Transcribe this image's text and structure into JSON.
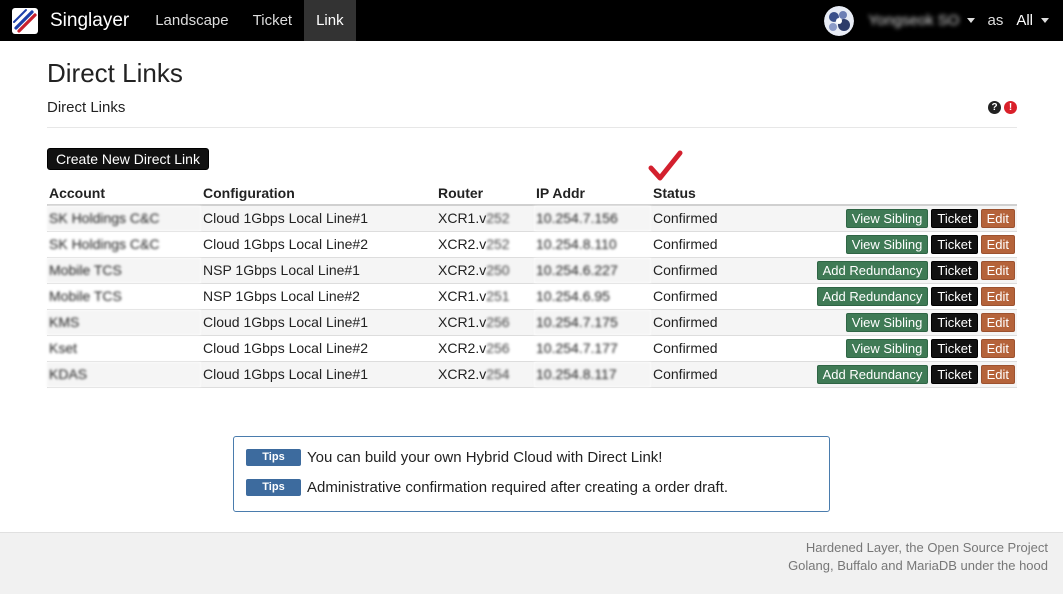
{
  "nav": {
    "brand": "Singlayer",
    "links": [
      "Landscape",
      "Ticket",
      "Link"
    ],
    "active_link": "Link",
    "user_name": "Yongseok SO",
    "as_label": "as",
    "scope_selected": "All"
  },
  "header": {
    "title": "Direct Links",
    "subtitle": "Direct Links",
    "help_glyph": "?",
    "alert_glyph": "!"
  },
  "create_button_label": "Create New Direct Link",
  "table": {
    "columns": [
      "Account",
      "Configuration",
      "Router",
      "IP Addr",
      "Status"
    ],
    "rows": [
      {
        "account": "SK Holdings C&C",
        "configuration": "Cloud 1Gbps Local Line#1",
        "router": "XCR1.v252",
        "ip": "10.254.7.156",
        "status": "Confirmed",
        "primary_action": "View Sibling",
        "ticket": "Ticket",
        "edit": "Edit"
      },
      {
        "account": "SK Holdings C&C",
        "configuration": "Cloud 1Gbps Local Line#2",
        "router": "XCR2.v252",
        "ip": "10.254.8.110",
        "status": "Confirmed",
        "primary_action": "View Sibling",
        "ticket": "Ticket",
        "edit": "Edit"
      },
      {
        "account": "Mobile TCS",
        "configuration": "NSP 1Gbps Local Line#1",
        "router": "XCR2.v250",
        "ip": "10.254.6.227",
        "status": "Confirmed",
        "primary_action": "Add Redundancy",
        "ticket": "Ticket",
        "edit": "Edit"
      },
      {
        "account": "Mobile TCS",
        "configuration": "NSP 1Gbps Local Line#2",
        "router": "XCR1.v251",
        "ip": "10.254.6.95",
        "status": "Confirmed",
        "primary_action": "Add Redundancy",
        "ticket": "Ticket",
        "edit": "Edit"
      },
      {
        "account": "KMS",
        "configuration": "Cloud 1Gbps Local Line#1",
        "router": "XCR1.v256",
        "ip": "10.254.7.175",
        "status": "Confirmed",
        "primary_action": "View Sibling",
        "ticket": "Ticket",
        "edit": "Edit"
      },
      {
        "account": "Kset",
        "configuration": "Cloud 1Gbps Local Line#2",
        "router": "XCR2.v256",
        "ip": "10.254.7.177",
        "status": "Confirmed",
        "primary_action": "View Sibling",
        "ticket": "Ticket",
        "edit": "Edit"
      },
      {
        "account": "KDAS",
        "configuration": "Cloud 1Gbps Local Line#1",
        "router": "XCR2.v254",
        "ip": "10.254.8.117",
        "status": "Confirmed",
        "primary_action": "Add Redundancy",
        "ticket": "Ticket",
        "edit": "Edit"
      }
    ]
  },
  "tips": [
    {
      "badge": "Tips",
      "text": "You can build your own Hybrid Cloud with Direct Link!"
    },
    {
      "badge": "Tips",
      "text": "Administrative confirmation required after creating a order draft."
    }
  ],
  "footer": {
    "line1": "Hardened Layer, the Open Source Project",
    "line2": "Golang, Buffalo and MariaDB under the hood"
  },
  "colors": {
    "navbar": "#000000",
    "button_green": "#3f7a55",
    "button_dark": "#111111",
    "button_orange": "#b5633a",
    "tips_badge": "#3d6b9e",
    "checkmark": "#d3202e"
  },
  "icons": {
    "brand": "singlayer-logo-icon",
    "avatar": "user-avatar-icon",
    "help": "question-circle-icon",
    "alert": "exclamation-circle-icon",
    "checkmark": "red-checkmark-icon"
  }
}
